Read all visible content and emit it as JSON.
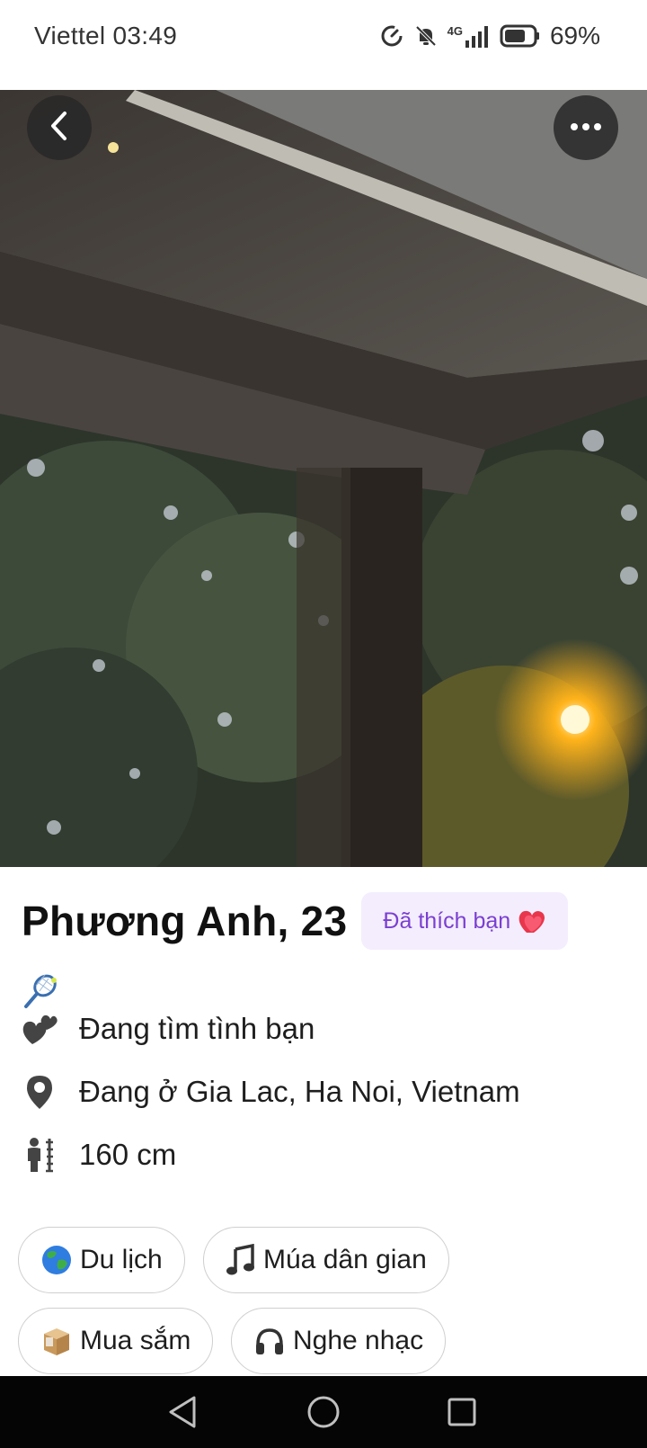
{
  "status": {
    "carrier": "Viettel",
    "time": "03:49",
    "network": "4G",
    "battery": "69%"
  },
  "header": {
    "back_icon": "chevron-left-icon",
    "more_icon": "more-horizontal-icon"
  },
  "profile": {
    "name_age": "Phương Anh, 23",
    "liked_badge": "Đã thích bạn",
    "liked_badge_icon": "heart-icon",
    "sport_icon": "badminton-racket-icon",
    "looking_for": "Đang tìm tình bạn",
    "location": "Đang ở Gia Lac, Ha Noi, Vietnam",
    "height": "160 cm"
  },
  "interests": [
    {
      "label": "Du lịch",
      "icon": "globe-icon"
    },
    {
      "label": "Múa dân gian",
      "icon": "music-note-icon"
    },
    {
      "label": "Mua sắm",
      "icon": "package-icon"
    },
    {
      "label": "Nghe nhạc",
      "icon": "headphones-icon"
    }
  ],
  "colors": {
    "badge_bg": "#f3edfd",
    "badge_text": "#7b3fd1",
    "nav_bg": "#050505"
  }
}
